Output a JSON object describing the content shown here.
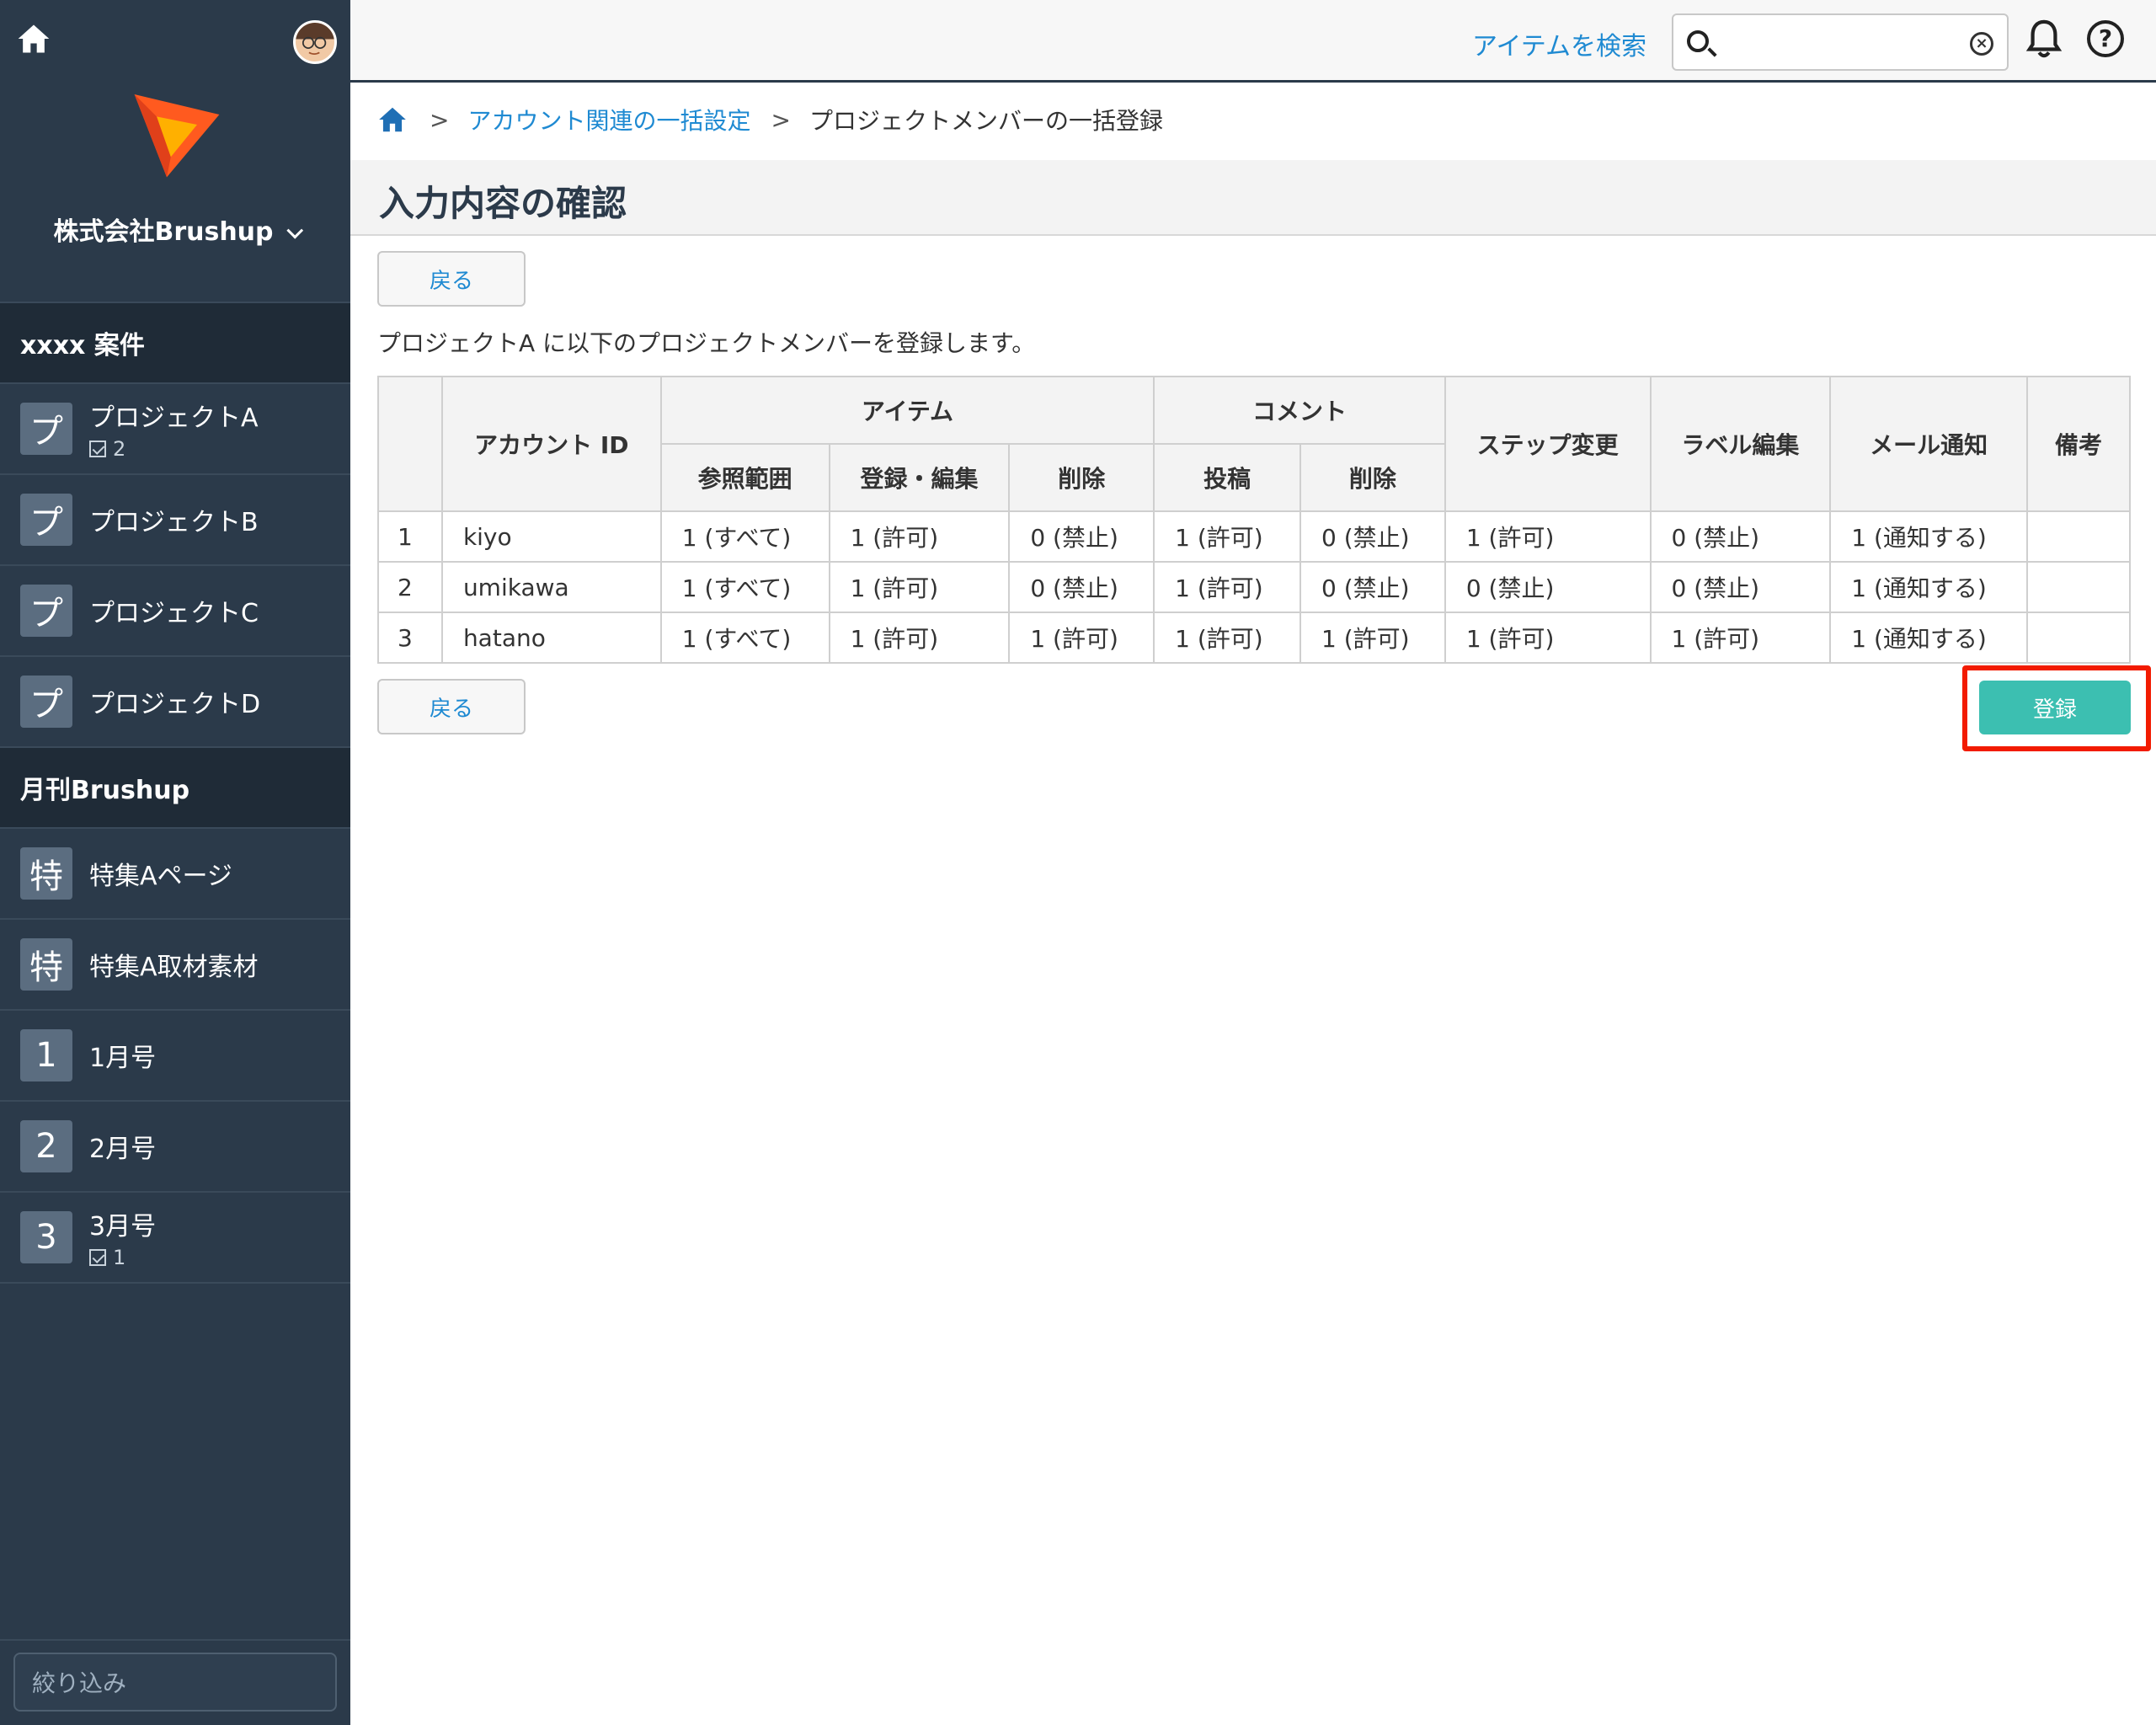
{
  "sidebar": {
    "company": "株式会社Brushup",
    "groups": [
      {
        "title": "xxxx 案件",
        "items": [
          {
            "badge": "プ",
            "label": "プロジェクトA",
            "count": "2"
          },
          {
            "badge": "プ",
            "label": "プロジェクトB",
            "count": ""
          },
          {
            "badge": "プ",
            "label": "プロジェクトC",
            "count": ""
          },
          {
            "badge": "プ",
            "label": "プロジェクトD",
            "count": ""
          }
        ]
      },
      {
        "title": "月刊Brushup",
        "items": [
          {
            "badge": "特",
            "label": "特集Aページ",
            "count": ""
          },
          {
            "badge": "特",
            "label": "特集A取材素材",
            "count": ""
          },
          {
            "badge": "1",
            "label": "1月号",
            "count": ""
          },
          {
            "badge": "2",
            "label": "2月号",
            "count": ""
          },
          {
            "badge": "3",
            "label": "3月号",
            "count": "1"
          }
        ]
      }
    ],
    "filter_placeholder": "絞り込み"
  },
  "header": {
    "search_link": "アイテムを検索",
    "search_value": ""
  },
  "breadcrumb": {
    "parent": "アカウント関連の一括設定",
    "current": "プロジェクトメンバーの一括登録",
    "separator": ">"
  },
  "page": {
    "title": "入力内容の確認",
    "back_label": "戻る",
    "register_label": "登録",
    "intro": "プロジェクトA に以下のプロジェクトメンバーを登録します。"
  },
  "table": {
    "headers": {
      "account_id": "アカウント ID",
      "item": "アイテム",
      "comment": "コメント",
      "step_change": "ステップ変更",
      "label_edit": "ラベル編集",
      "mail_notify": "メール通知",
      "remarks": "備考",
      "item_scope": "参照範囲",
      "item_edit": "登録・編集",
      "item_delete": "削除",
      "comment_post": "投稿",
      "comment_delete": "削除"
    },
    "rows": [
      {
        "no": "1",
        "account": "kiyo",
        "scope": "1 (すべて)",
        "edit": "1 (許可)",
        "delete": "0 (禁止)",
        "post": "1 (許可)",
        "cdelete": "0 (禁止)",
        "step": "1 (許可)",
        "label": "0 (禁止)",
        "mail": "1 (通知する)",
        "remarks": ""
      },
      {
        "no": "2",
        "account": "umikawa",
        "scope": "1 (すべて)",
        "edit": "1 (許可)",
        "delete": "0 (禁止)",
        "post": "1 (許可)",
        "cdelete": "0 (禁止)",
        "step": "0 (禁止)",
        "label": "0 (禁止)",
        "mail": "1 (通知する)",
        "remarks": ""
      },
      {
        "no": "3",
        "account": "hatano",
        "scope": "1 (すべて)",
        "edit": "1 (許可)",
        "delete": "1 (許可)",
        "post": "1 (許可)",
        "cdelete": "1 (許可)",
        "step": "1 (許可)",
        "label": "1 (許可)",
        "mail": "1 (通知する)",
        "remarks": ""
      }
    ]
  },
  "colors": {
    "sidebar_bg": "#2b3a4a",
    "accent_link": "#1f8ad2",
    "register_button": "#3cbfb1",
    "highlight_border": "#f21b00"
  }
}
